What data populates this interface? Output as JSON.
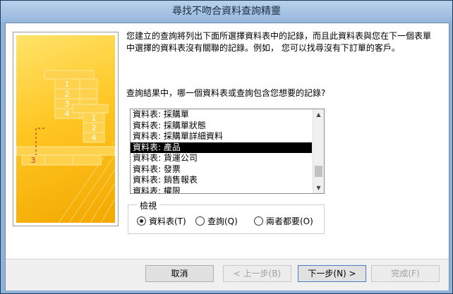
{
  "window": {
    "title": "尋找不吻合資料查詢精靈"
  },
  "description": "您建立的查詢將列出下面所選擇資料表中的記錄，而且此資料表與您在下一個表單中選擇的資料表沒有關聯的記錄。例如，您可以找尋沒有下訂單的客戶。",
  "description_lines": [
    "您建立的查詢將列出下面所選擇資料表中的記錄，而且此資料表與您在下一個表單",
    "中選擇的資料表沒有關聯的記錄。例如， 您可以找尋沒有下訂單的客戶。"
  ],
  "question": "查詢結果中，哪一個資料表或查詢包含您想要的記錄?",
  "list": {
    "items": [
      "資料表: 採購單",
      "資料表: 採購單狀態",
      "資料表: 採購單詳細資料",
      "資料表: 產品",
      "資料表: 貨運公司",
      "資料表: 發票",
      "資料表: 銷售報表",
      "資料表: 權限"
    ],
    "selected_index": 3
  },
  "view_group": {
    "label": "檢視",
    "options": [
      "資料表(T)",
      "查詢(Q)",
      "兩者都要(O)"
    ],
    "selected_index": 0
  },
  "buttons": {
    "cancel": "取消",
    "back": "< 上一步(B)",
    "next": "下一步(N) >",
    "finish": "完成(F)"
  },
  "art": {
    "numbers_top": [
      "1",
      "2",
      "3",
      "4"
    ],
    "numbers_mid": [
      "1",
      "2",
      "4"
    ],
    "number_bottom": "3"
  },
  "colors": {
    "titlebar": "#a7c4e4",
    "selection": "#000000",
    "art_yellow": "#ffc623"
  }
}
